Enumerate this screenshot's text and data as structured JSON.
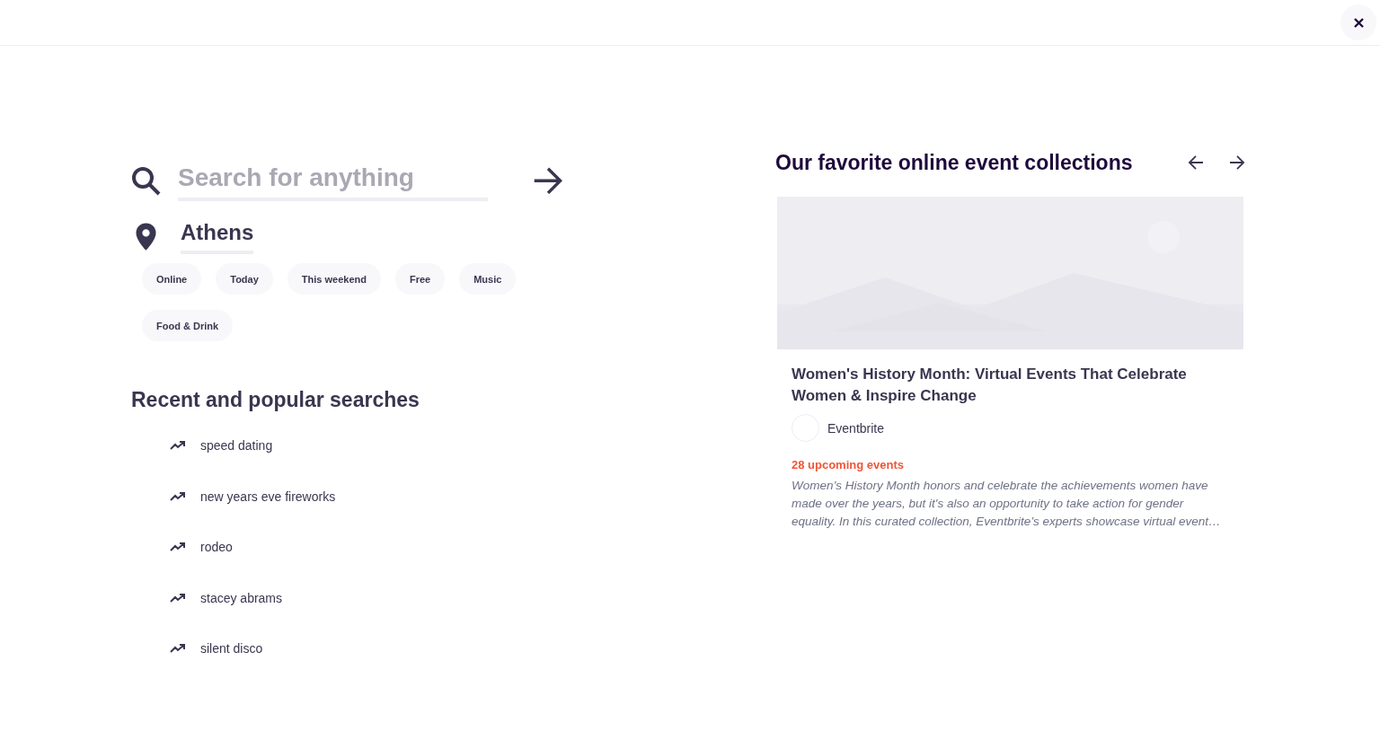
{
  "search": {
    "placeholder": "Search for anything"
  },
  "location": {
    "value": "Athens"
  },
  "chips": [
    {
      "label": "Online"
    },
    {
      "label": "Today"
    },
    {
      "label": "This weekend"
    },
    {
      "label": "Free"
    },
    {
      "label": "Music"
    },
    {
      "label": "Food & Drink"
    }
  ],
  "recent_searches": {
    "title": "Recent and popular searches",
    "items": [
      "speed dating",
      "new years eve fireworks",
      "rodeo",
      "stacey abrams",
      "silent disco"
    ]
  },
  "collections": {
    "title": "Our favorite online event collections",
    "card": {
      "title": "Women's History Month: Virtual Events That Celebrate Women & Inspire Change",
      "organizer": "Eventbrite",
      "count": "28 upcoming events",
      "description": "Women’s History Month honors and celebrate the achievements women have made over the years, but it's also an opportunity to take action for gender equality. In this curated collection, Eventbrite’s experts showcase virtual event…"
    }
  }
}
